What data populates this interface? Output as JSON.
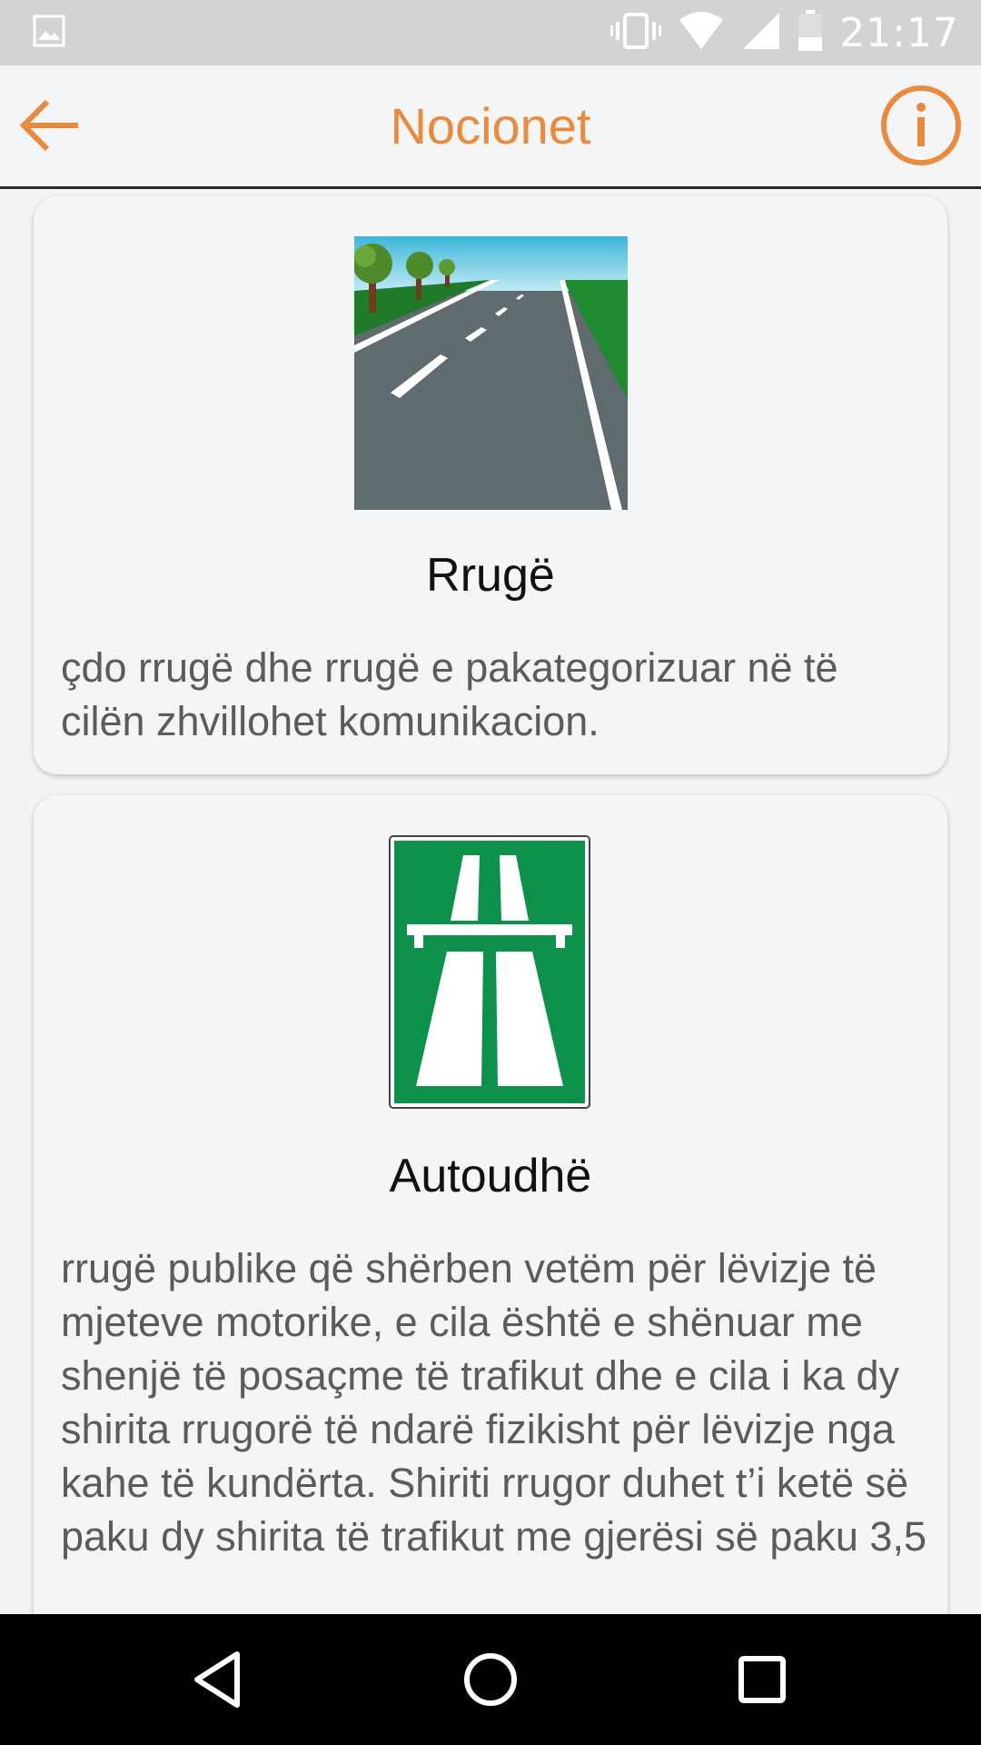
{
  "status_bar": {
    "time": "21:17",
    "icons": [
      "image-notification-icon",
      "vibrate-icon",
      "wifi-icon",
      "cell-signal-icon",
      "battery-icon"
    ]
  },
  "app_bar": {
    "title": "Nocionet",
    "back_icon": "arrow-left-icon",
    "info_icon": "info-circle-icon",
    "accent_color": "#ea8a3f"
  },
  "cards": [
    {
      "title": "Rrugë",
      "description": "çdo rrugë dhe rrugë e pakategorizuar në të cilën zhvillohet komunikacion.",
      "image": "road-illustration"
    },
    {
      "title": "Autoudhë",
      "description": "rrugë publike që shërben vetëm për lëvizje të mjeteve motorike, e cila është e shënuar me shenjë të posaçme të trafikut dhe e cila i ka dy shirita rrugorë të ndarë fizikisht për lëvizje nga kahe të kundërta. Shiriti rrugor duhet t’i ketë së paku dy shirita të trafikut me gjerësi së paku 3,5",
      "image": "motorway-sign",
      "sign_color": "#0e914a"
    }
  ],
  "nav_bar": {
    "buttons": [
      "back-triangle-icon",
      "home-circle-icon",
      "recents-square-icon"
    ]
  }
}
